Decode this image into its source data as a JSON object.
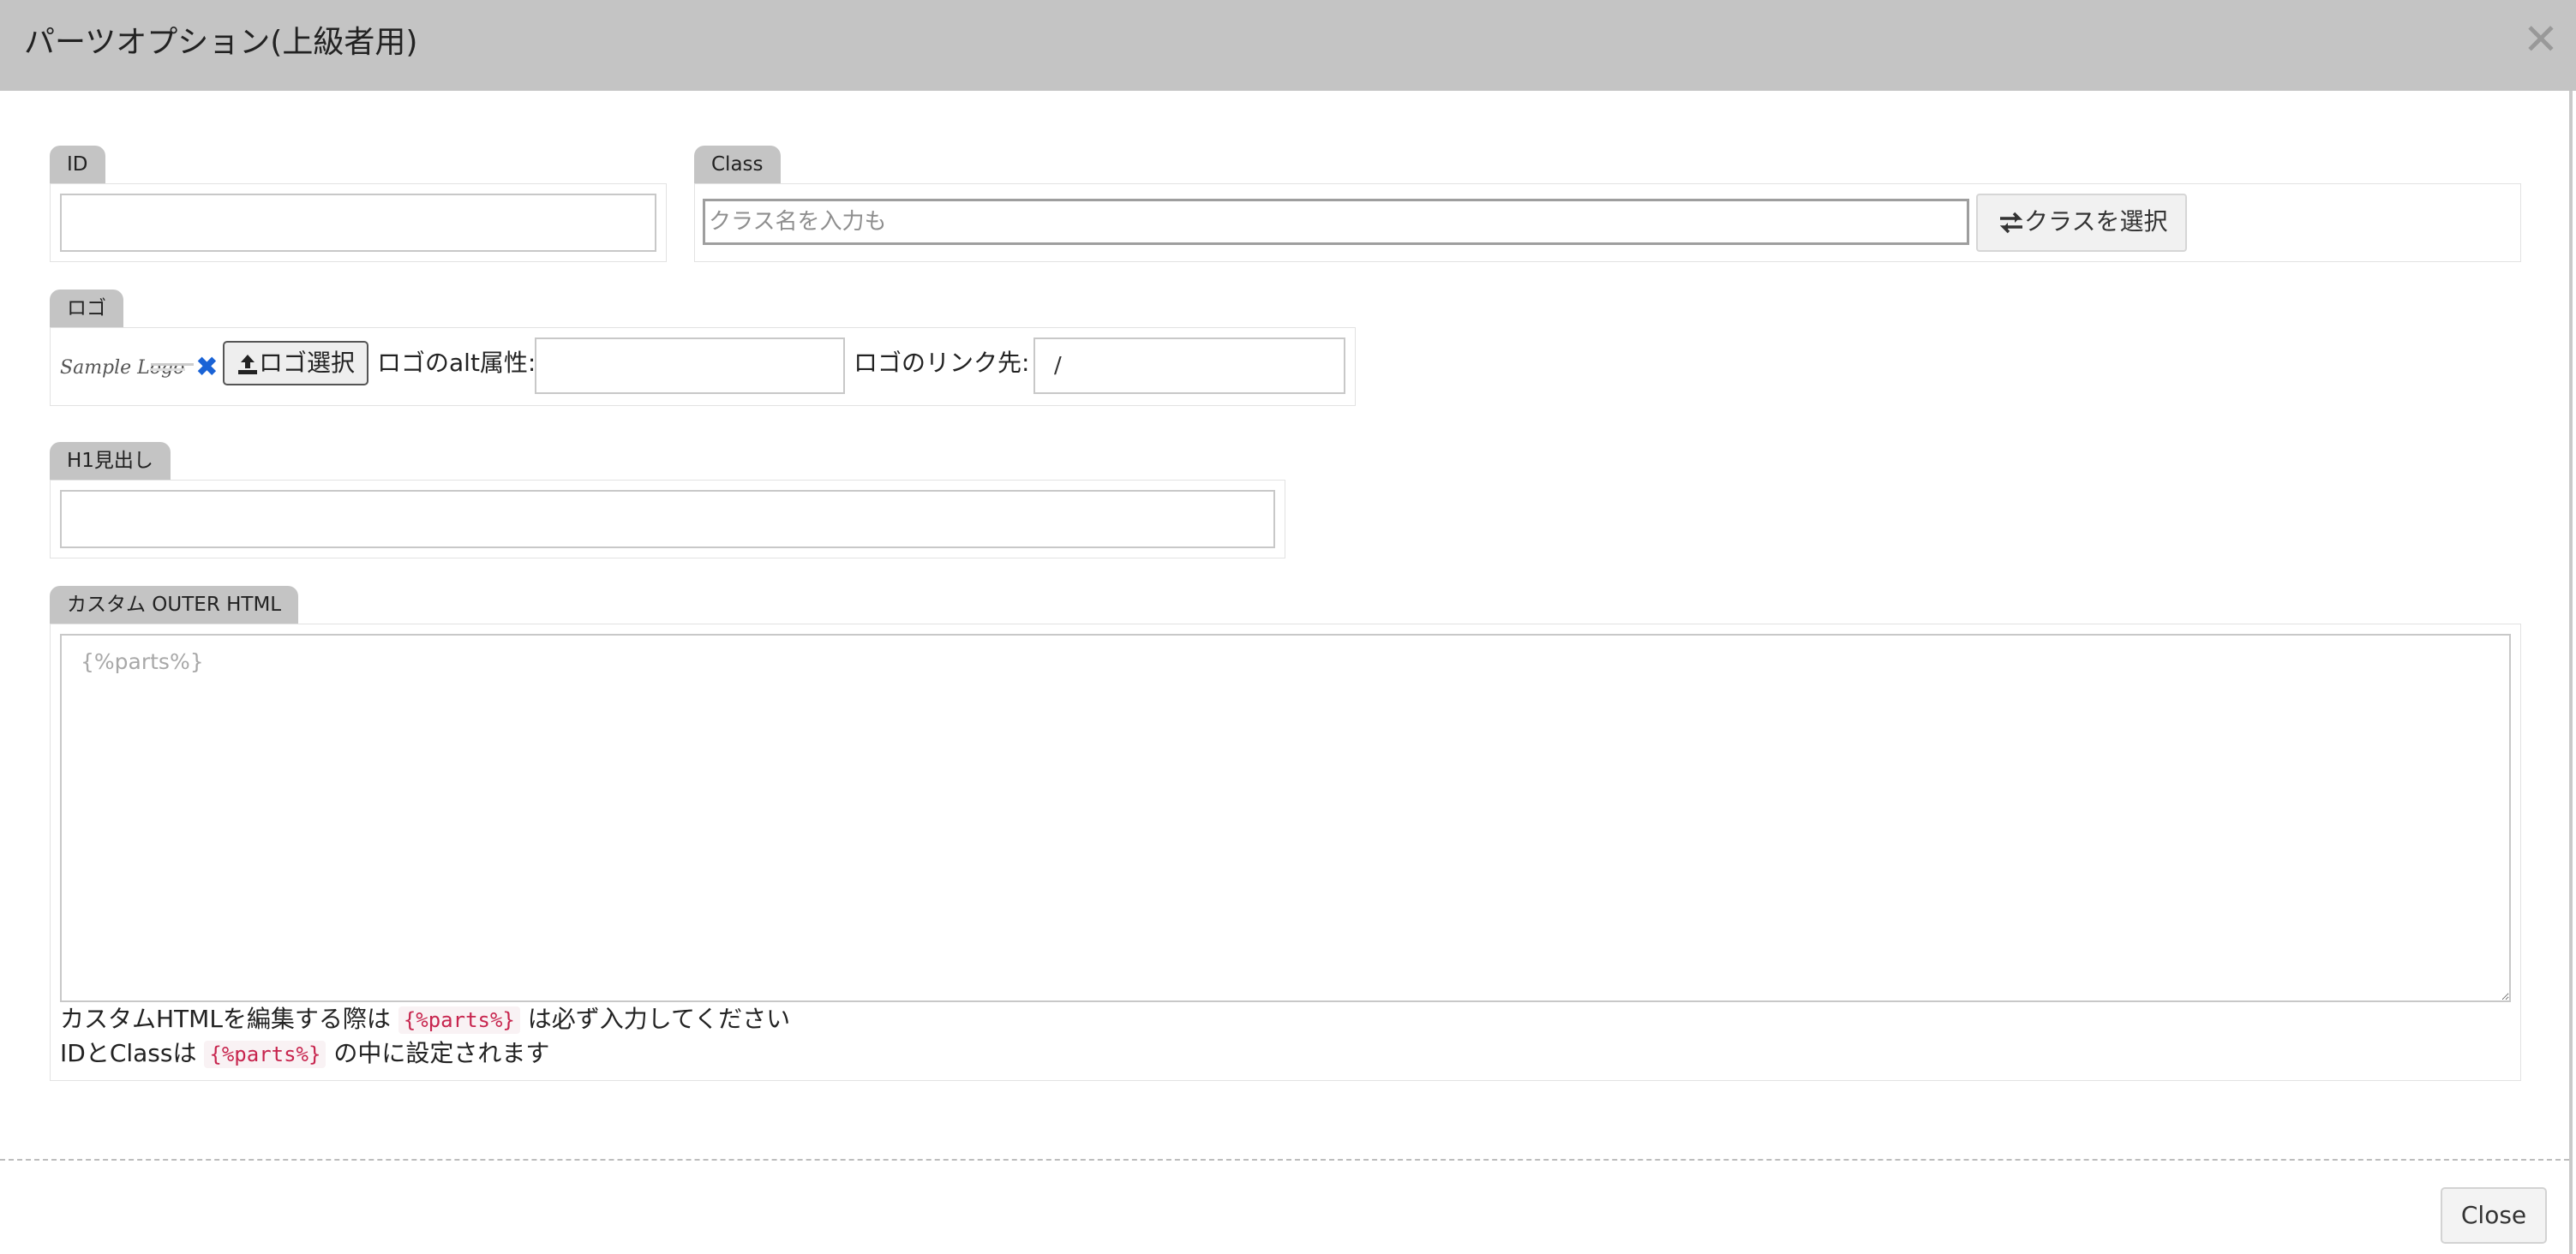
{
  "dialog": {
    "title": "パーツオプション(上級者用)",
    "close_label": "Close"
  },
  "id_field": {
    "label": "ID",
    "value": ""
  },
  "class_field": {
    "label": "Class",
    "placeholder": "クラス名を入力も",
    "value": "",
    "select_button": "クラスを選択"
  },
  "logo_field": {
    "label": "ロゴ",
    "logo_text": "Sample Logo",
    "select_button": "ロゴ選択",
    "alt_label": "ロゴのalt属性:",
    "alt_value": "",
    "link_label": "ロゴのリンク先:",
    "link_value": "/"
  },
  "h1_field": {
    "label": "H1見出し",
    "value": ""
  },
  "outer_html_field": {
    "label": "カスタム OUTER HTML",
    "placeholder": "{%parts%}",
    "help_1_before": "カスタムHTMLを編集する際は",
    "help_1_code": "{%parts%}",
    "help_1_after": "は必ず入力してください",
    "help_2_before": "IDとClassは",
    "help_2_code": "{%parts%}",
    "help_2_after": "の中に設定されます"
  },
  "icons": {
    "close": "close-icon",
    "exchange": "exchange-icon",
    "upload": "upload-icon",
    "remove": "remove-icon"
  },
  "colors": {
    "header_bg": "#c4c4c4",
    "remove_icon": "#1a63d6",
    "code_text": "#c7254e"
  }
}
